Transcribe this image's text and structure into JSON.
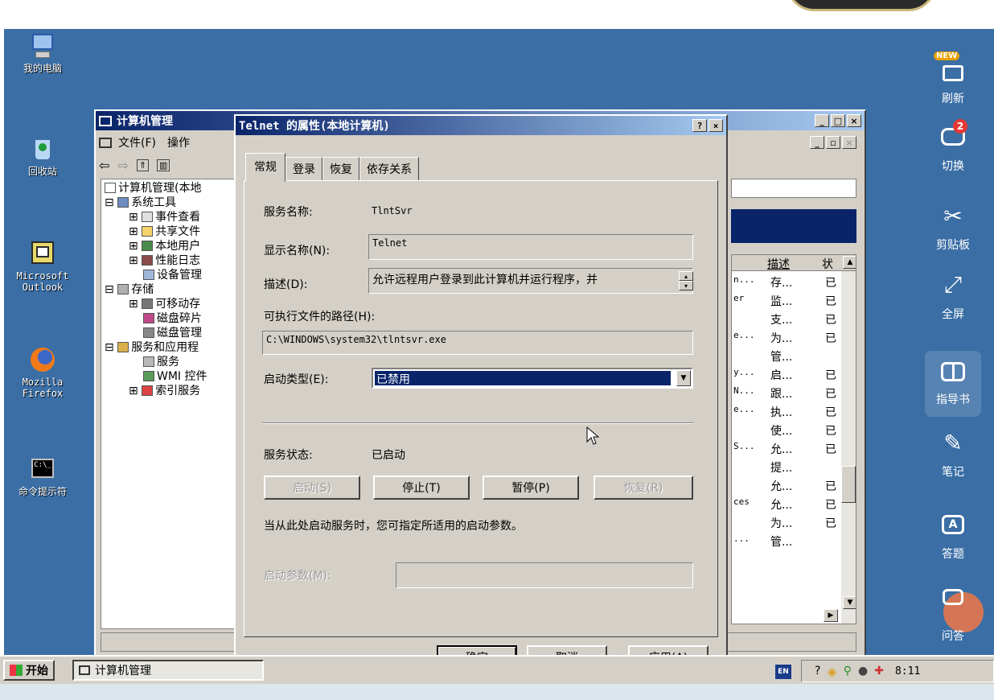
{
  "desktop": {
    "icons": [
      {
        "label": "我的电脑",
        "icon": "my-computer-icon"
      },
      {
        "label": "回收站",
        "icon": "recycle-bin-icon"
      },
      {
        "label": "Microsoft\nOutlook",
        "icon": "outlook-icon"
      },
      {
        "label": "Mozilla\nFirefox",
        "icon": "firefox-icon"
      },
      {
        "label": "命令提示符",
        "icon": "command-prompt-icon"
      }
    ]
  },
  "sidebar": {
    "items": [
      {
        "label": "刷新",
        "icon": "refresh-icon",
        "badge": "NEW"
      },
      {
        "label": "切换",
        "icon": "switch-icon",
        "badge": "2"
      },
      {
        "label": "剪贴板",
        "icon": "scissors-icon"
      },
      {
        "label": "全屏",
        "icon": "fullscreen-icon"
      },
      {
        "label": "指导书",
        "icon": "guide-book-icon"
      },
      {
        "label": "笔记",
        "icon": "pencil-icon"
      },
      {
        "label": "答题",
        "icon": "answer-icon"
      },
      {
        "label": "问答",
        "icon": "qa-icon"
      }
    ]
  },
  "cm": {
    "title": "计算机管理",
    "menu": {
      "file": "文件(F)",
      "action": "操作"
    },
    "tree": [
      "计算机管理(本地",
      "系统工具",
      "事件查看",
      "共享文件",
      "本地用户",
      "性能日志",
      "设备管理",
      "存储",
      "可移动存",
      "磁盘碎片",
      "磁盘管理",
      "服务和应用程",
      "服务",
      "WMI 控件",
      "索引服务"
    ],
    "list": {
      "col_desc": "描述",
      "col_status": "状",
      "rows": [
        {
          "c": "n...",
          "d": "存...",
          "s": "已"
        },
        {
          "c": "er",
          "d": "监...",
          "s": "已"
        },
        {
          "c": "",
          "d": "支...",
          "s": "已"
        },
        {
          "c": "e...",
          "d": "为...",
          "s": "已"
        },
        {
          "c": "",
          "d": "管...",
          "s": ""
        },
        {
          "c": "y...",
          "d": "启...",
          "s": "已"
        },
        {
          "c": "N...",
          "d": "跟...",
          "s": "已"
        },
        {
          "c": "e...",
          "d": "执...",
          "s": "已"
        },
        {
          "c": "",
          "d": "使...",
          "s": "已"
        },
        {
          "c": "S...",
          "d": "允...",
          "s": "已"
        },
        {
          "c": "",
          "d": "提...",
          "s": ""
        },
        {
          "c": "",
          "d": "允...",
          "s": "已"
        },
        {
          "c": "ces",
          "d": "允...",
          "s": "已"
        },
        {
          "c": "",
          "d": "为...",
          "s": "已"
        },
        {
          "c": "...",
          "d": "管...",
          "s": ""
        }
      ]
    }
  },
  "dialog": {
    "title": "Telnet 的属性(本地计算机)",
    "help": "?",
    "close": "×",
    "tabs": [
      "常规",
      "登录",
      "恢复",
      "依存关系"
    ],
    "service_name_label": "服务名称:",
    "service_name": "TlntSvr",
    "display_name_label": "显示名称(N):",
    "display_name": "Telnet",
    "desc_label": "描述(D):",
    "desc": "允许远程用户登录到此计算机并运行程序，并",
    "path_label": "可执行文件的路径(H):",
    "path": "C:\\WINDOWS\\system32\\tlntsvr.exe",
    "startup_label": "启动类型(E):",
    "startup_value": "已禁用",
    "status_label": "服务状态:",
    "status_value": "已启动",
    "btn_start": "启动(S)",
    "btn_stop": "停止(T)",
    "btn_pause": "暂停(P)",
    "btn_resume": "恢复(R)",
    "hint": "当从此处启动服务时，您可指定所适用的启动参数。",
    "params_label": "启动参数(M):",
    "params_value": "",
    "ok": "确定",
    "cancel": "取消",
    "apply": "应用(A)"
  },
  "taskbar": {
    "start": "开始",
    "task": "计算机管理",
    "lang": "EN",
    "clock": "8:11"
  }
}
